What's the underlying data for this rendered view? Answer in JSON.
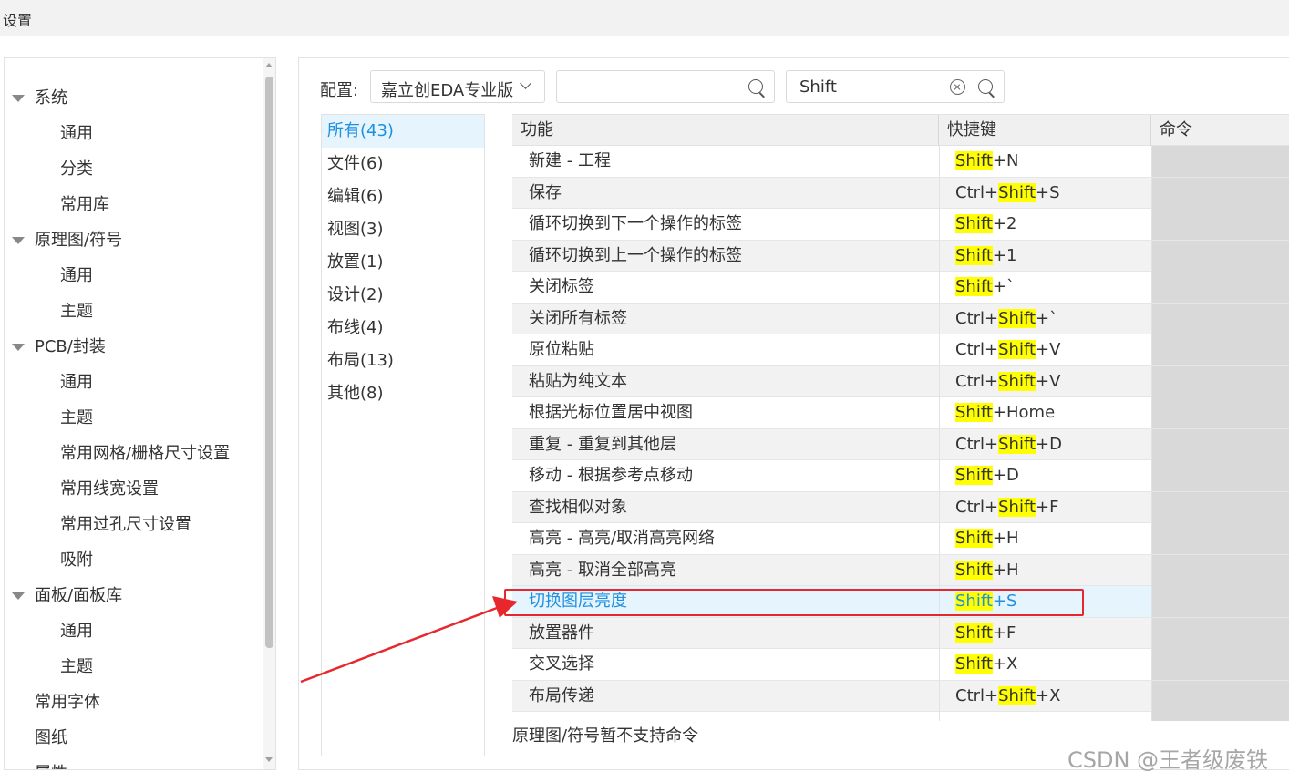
{
  "window": {
    "title": "设置"
  },
  "sidebar": {
    "items": [
      {
        "label": "系统",
        "level": 0,
        "expanded": true
      },
      {
        "label": "通用",
        "level": 1
      },
      {
        "label": "分类",
        "level": 1
      },
      {
        "label": "常用库",
        "level": 1
      },
      {
        "label": "原理图/符号",
        "level": 0,
        "expanded": true
      },
      {
        "label": "通用",
        "level": 1
      },
      {
        "label": "主题",
        "level": 1
      },
      {
        "label": "PCB/封装",
        "level": 0,
        "expanded": true
      },
      {
        "label": "通用",
        "level": 1
      },
      {
        "label": "主题",
        "level": 1
      },
      {
        "label": "常用网格/栅格尺寸设置",
        "level": 1
      },
      {
        "label": "常用线宽设置",
        "level": 1
      },
      {
        "label": "常用过孔尺寸设置",
        "level": 1
      },
      {
        "label": "吸附",
        "level": 1
      },
      {
        "label": "面板/面板库",
        "level": 0,
        "expanded": true
      },
      {
        "label": "通用",
        "level": 1
      },
      {
        "label": "主题",
        "level": 1
      },
      {
        "label": "常用字体",
        "level": 0,
        "leaf": true
      },
      {
        "label": "图纸",
        "level": 0,
        "leaf": true
      },
      {
        "label": "属性",
        "level": 0,
        "leaf": true
      }
    ]
  },
  "toolbar": {
    "config_label": "配置:",
    "config_value": "嘉立创EDA专业版",
    "search_command_value": "",
    "search_key_value": "Shift"
  },
  "categories": [
    {
      "label": "所有(43)",
      "active": true
    },
    {
      "label": "文件(6)"
    },
    {
      "label": "编辑(6)"
    },
    {
      "label": "视图(3)"
    },
    {
      "label": "放置(1)"
    },
    {
      "label": "设计(2)"
    },
    {
      "label": "布线(4)"
    },
    {
      "label": "布局(13)"
    },
    {
      "label": "其他(8)"
    }
  ],
  "table": {
    "columns": [
      "功能",
      "快捷键",
      "命令"
    ],
    "highlight_term": "Shift",
    "rows": [
      {
        "function": "新建 - 工程",
        "shortcut": "Shift+N"
      },
      {
        "function": "保存",
        "shortcut": "Ctrl+Shift+S"
      },
      {
        "function": "循环切换到下一个操作的标签",
        "shortcut": "Shift+2"
      },
      {
        "function": "循环切换到上一个操作的标签",
        "shortcut": "Shift+1"
      },
      {
        "function": "关闭标签",
        "shortcut": "Shift+`"
      },
      {
        "function": "关闭所有标签",
        "shortcut": "Ctrl+Shift+`"
      },
      {
        "function": "原位粘贴",
        "shortcut": "Ctrl+Shift+V"
      },
      {
        "function": "粘贴为纯文本",
        "shortcut": "Ctrl+Shift+V"
      },
      {
        "function": "根据光标位置居中视图",
        "shortcut": "Shift+Home"
      },
      {
        "function": "重复 - 重复到其他层",
        "shortcut": "Ctrl+Shift+D"
      },
      {
        "function": "移动 - 根据参考点移动",
        "shortcut": "Shift+D"
      },
      {
        "function": "查找相似对象",
        "shortcut": "Ctrl+Shift+F"
      },
      {
        "function": "高亮 - 高亮/取消高亮网络",
        "shortcut": "Shift+H"
      },
      {
        "function": "高亮 - 取消全部高亮",
        "shortcut": "Shift+H"
      },
      {
        "function": "切换图层亮度",
        "shortcut": "Shift+S",
        "selected": true
      },
      {
        "function": "放置器件",
        "shortcut": "Shift+F"
      },
      {
        "function": "交叉选择",
        "shortcut": "Shift+X"
      },
      {
        "function": "布局传递",
        "shortcut": "Ctrl+Shift+X"
      },
      {
        "function": "",
        "shortcut": ""
      }
    ]
  },
  "footer_note": "原理图/符号暂不支持命令",
  "watermark": "CSDN @王者级废铁",
  "colors": {
    "accent": "#1e90e0",
    "highlight": "#ffff00",
    "annotation": "#e8272c",
    "selected_row": "#e6f4fd"
  }
}
